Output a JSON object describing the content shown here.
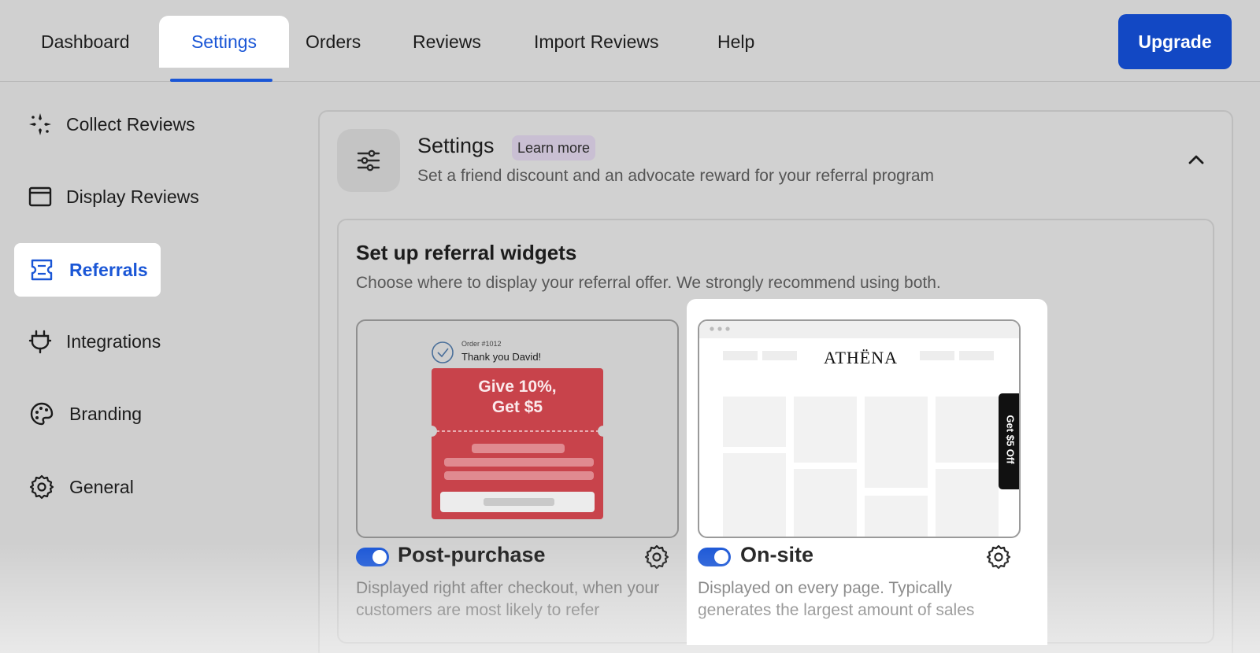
{
  "nav": {
    "tabs": [
      {
        "label": "Dashboard"
      },
      {
        "label": "Settings"
      },
      {
        "label": "Orders"
      },
      {
        "label": "Reviews"
      },
      {
        "label": "Import Reviews"
      },
      {
        "label": "Help"
      }
    ],
    "active_tab": "Settings",
    "upgrade_label": "Upgrade"
  },
  "sidebar": {
    "items": [
      {
        "label": "Collect Reviews",
        "icon": "sparkle-icon"
      },
      {
        "label": "Display Reviews",
        "icon": "browser-window-icon"
      },
      {
        "label": "Referrals",
        "icon": "ticket-icon"
      },
      {
        "label": "Integrations",
        "icon": "plug-icon"
      },
      {
        "label": "Branding",
        "icon": "palette-icon"
      },
      {
        "label": "General",
        "icon": "gear-icon"
      }
    ],
    "active_item": "Referrals"
  },
  "settings_card": {
    "title": "Settings",
    "learn_more": "Learn more",
    "subtitle": "Set a friend discount and an advocate reward for your referral program",
    "expanded": true
  },
  "widgets_section": {
    "title": "Set up referral widgets",
    "subtitle": "Choose where to display your referral offer. We strongly recommend using both.",
    "widgets": [
      {
        "title": "Post-purchase",
        "enabled": true,
        "description": "Displayed right after checkout, when your customers are most likely to refer",
        "preview": {
          "order_label": "Order #1012",
          "thank_you": "Thank you David!",
          "offer_line1": "Give 10%,",
          "offer_line2": "Get $5"
        }
      },
      {
        "title": "On-site",
        "enabled": true,
        "description": "Displayed on every page. Typically generates the largest amount of sales",
        "preview": {
          "brand": "ATHËNA",
          "side_tab": "Get $5 Off"
        }
      }
    ]
  },
  "colors": {
    "accent": "#1a56d6",
    "upgrade_bg": "#1248c4",
    "coupon_red": "#c8434b"
  }
}
